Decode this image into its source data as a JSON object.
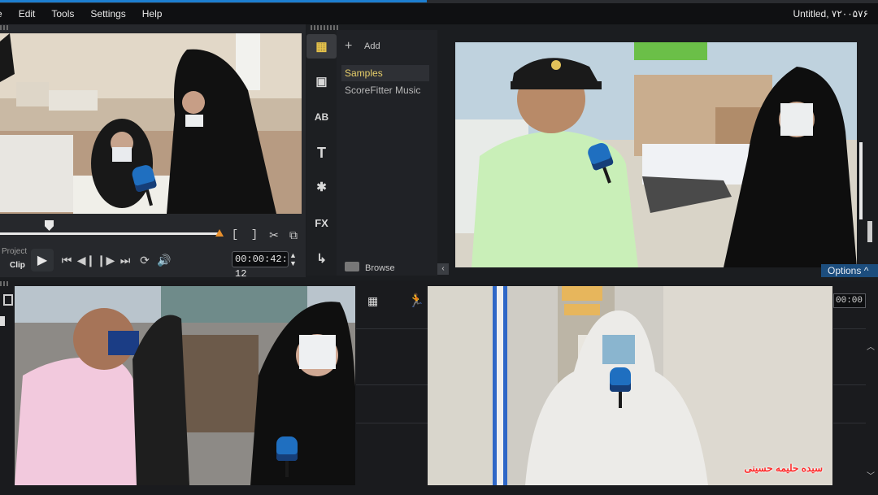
{
  "window": {
    "title": "Untitled, ۷۲۰۰۵۷۶"
  },
  "menu": {
    "items": [
      "e",
      "Edit",
      "Tools",
      "Settings",
      "Help"
    ]
  },
  "preview": {
    "mode_project": "Project",
    "mode_clip": "Clip",
    "timecode": "00:00:42: 12",
    "bracket_in": "[",
    "bracket_out": "]"
  },
  "library": {
    "add_label": "Add",
    "items": [
      "Samples",
      "ScoreFitter Music"
    ],
    "browse_label": "Browse",
    "options_label": "Options"
  },
  "timeline": {
    "timecode": "00:00"
  },
  "overlay": {
    "caption": "سیده حلیمه حسینی"
  },
  "icons": [
    "play-icon",
    "prev-icon",
    "step-back-icon",
    "step-forward-icon",
    "next-icon",
    "repeat-icon",
    "volume-icon",
    "scissors-icon",
    "copy-icon",
    "media-icon",
    "instant-project-icon",
    "title-icon",
    "text-icon",
    "transition-icon",
    "fx-icon",
    "path-icon",
    "add-icon",
    "browse-icon",
    "storyboard-icon",
    "run-icon"
  ]
}
